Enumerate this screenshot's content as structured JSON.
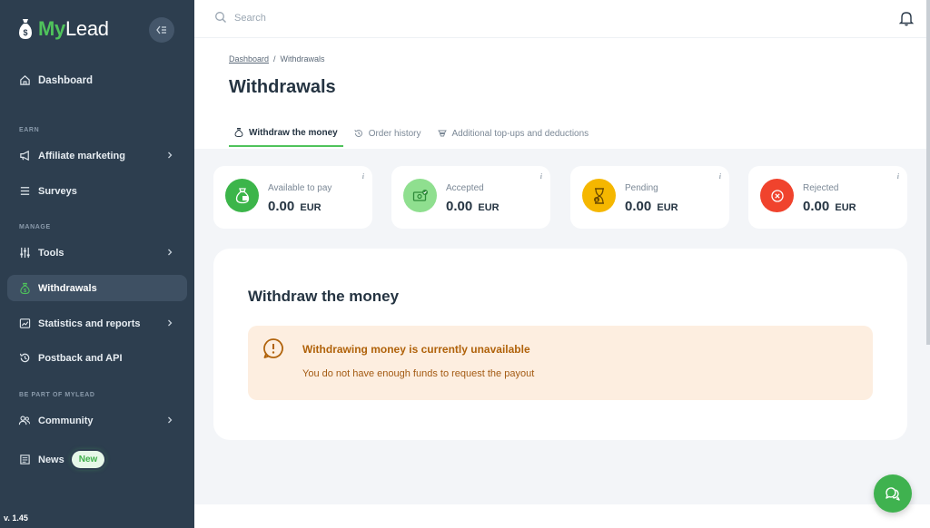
{
  "app": {
    "logo_my": "My",
    "logo_lead": "Lead",
    "version": "v. 1.45"
  },
  "sidebar": {
    "dashboard": {
      "label": "Dashboard",
      "icon": "home-icon"
    },
    "sections": {
      "earn": "EARN",
      "manage": "MANAGE",
      "be_part": "BE PART OF MYLEAD"
    },
    "items": {
      "affiliate_marketing": {
        "label": "Affiliate marketing",
        "icon": "megaphone-icon"
      },
      "surveys": {
        "label": "Surveys",
        "icon": "list-icon"
      },
      "tools": {
        "label": "Tools",
        "icon": "sliders-icon"
      },
      "withdrawals": {
        "label": "Withdrawals",
        "icon": "money-bag-icon",
        "active": true
      },
      "statistics": {
        "label": "Statistics and reports",
        "icon": "chart-icon"
      },
      "postback": {
        "label": "Postback and API",
        "icon": "history-icon"
      },
      "community": {
        "label": "Community",
        "icon": "users-icon"
      },
      "news": {
        "label": "News",
        "icon": "newspaper-icon",
        "badge": "New"
      }
    }
  },
  "topbar": {
    "search_placeholder": "Search"
  },
  "breadcrumb": {
    "link": "Dashboard",
    "separator": "/",
    "current": "Withdrawals"
  },
  "page_title": "Withdrawals",
  "tabs": [
    {
      "label": "Withdraw the money",
      "active": true,
      "icon": "money-bag-icon"
    },
    {
      "label": "Order history",
      "active": false,
      "icon": "history-icon"
    },
    {
      "label": "Additional top-ups and deductions",
      "active": false,
      "icon": "stack-icon"
    }
  ],
  "stats": [
    {
      "label": "Available to pay",
      "value": "0.00",
      "currency": "EUR",
      "color": "#3cb54a",
      "icon": "money-bag-icon"
    },
    {
      "label": "Accepted",
      "value": "0.00",
      "currency": "EUR",
      "color": "#8fdf8f",
      "icon": "check-cash-icon"
    },
    {
      "label": "Pending",
      "value": "0.00",
      "currency": "EUR",
      "color": "#f5b700",
      "icon": "hourglass-icon"
    },
    {
      "label": "Rejected",
      "value": "0.00",
      "currency": "EUR",
      "color": "#f0432d",
      "icon": "close-circle-icon"
    }
  ],
  "main": {
    "title": "Withdraw the money",
    "alert_title": "Withdrawing money is currently unavailable",
    "alert_text": "You do not have enough funds to request the payout"
  },
  "colors": {
    "sidebar_bg": "#2d3e4f",
    "accent": "#4fc35b",
    "alert_bg": "#fdeee0",
    "alert_text": "#b0620a"
  }
}
